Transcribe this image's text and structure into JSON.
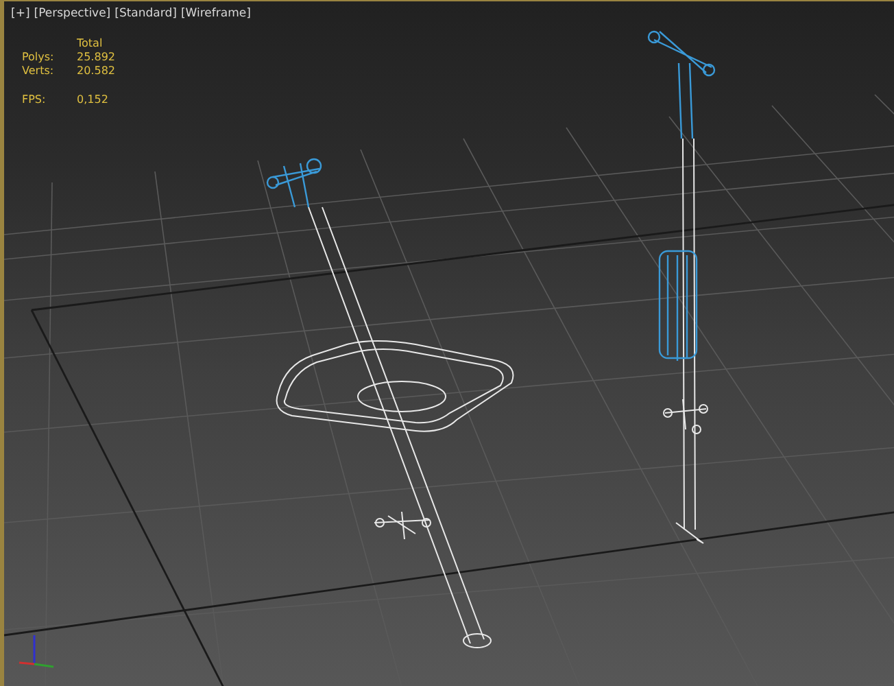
{
  "viewport": {
    "labels": [
      "[+]",
      "[Perspective]",
      "[Standard]",
      "[Wireframe]"
    ],
    "stats": {
      "header": "Total",
      "rows": [
        {
          "label": "Polys:",
          "value": "25.892"
        },
        {
          "label": "Verts:",
          "value": "20.582"
        }
      ],
      "fps": {
        "label": "FPS:",
        "value": "0,152"
      }
    }
  }
}
